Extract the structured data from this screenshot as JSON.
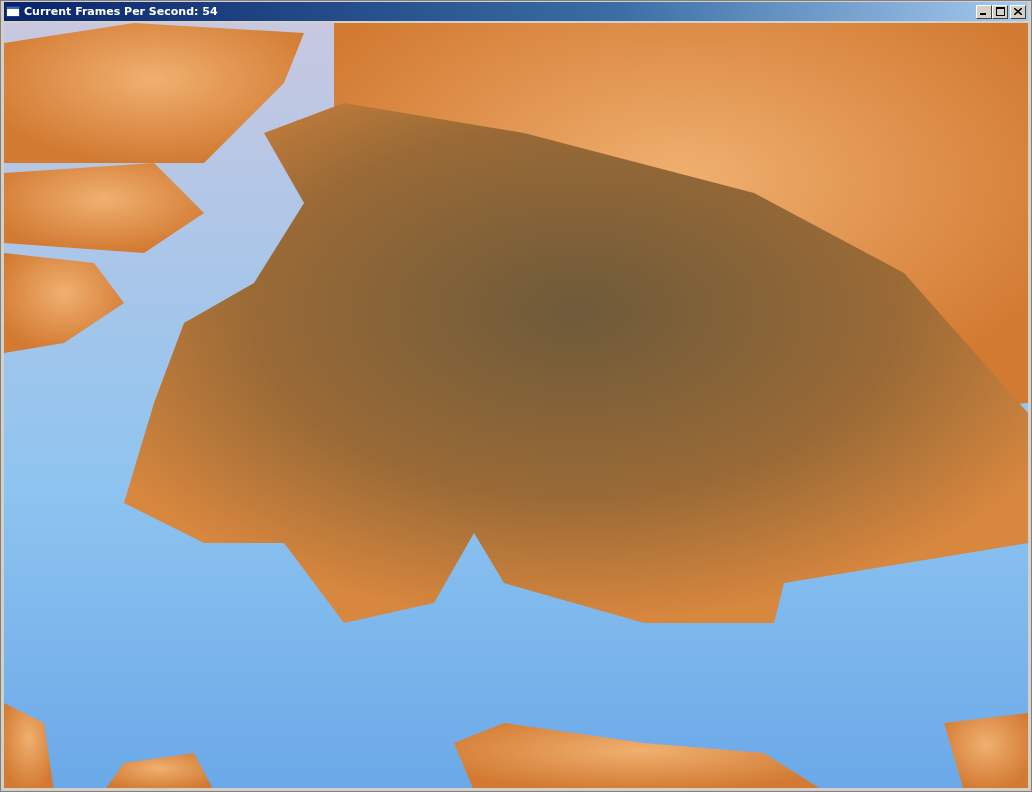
{
  "window": {
    "title": "Current Frames Per Second: 54"
  }
}
